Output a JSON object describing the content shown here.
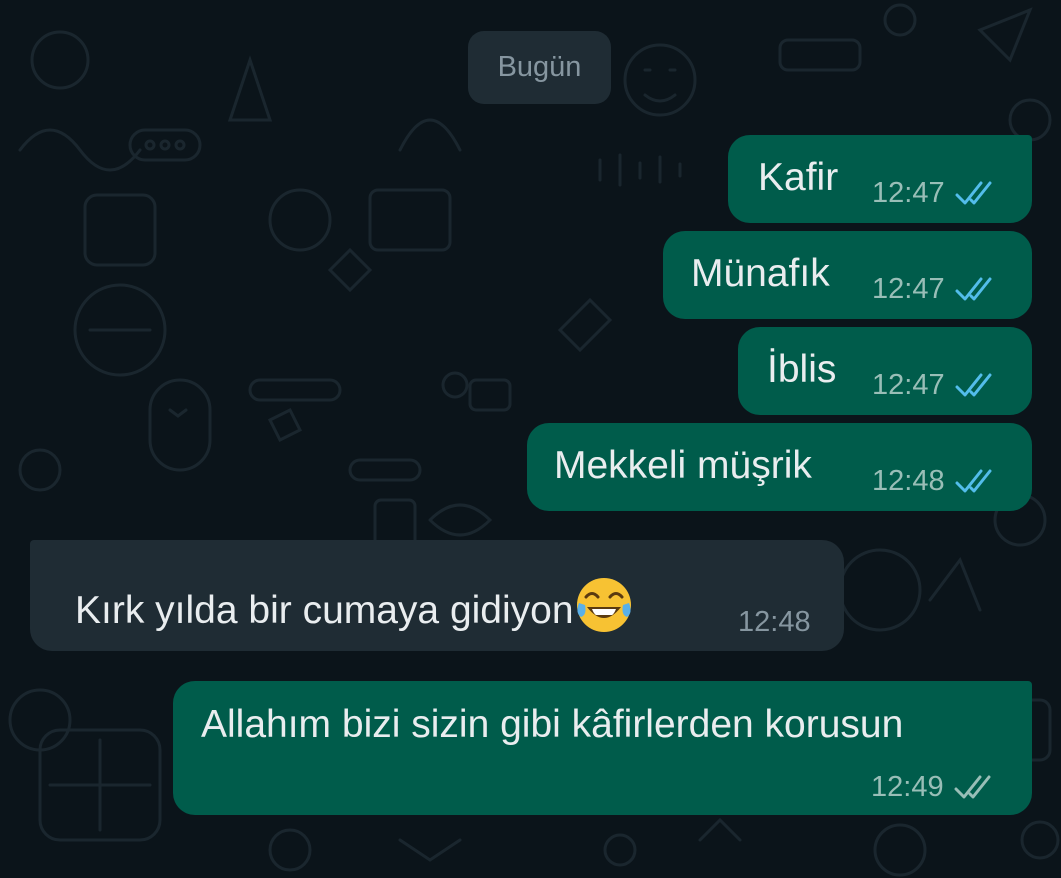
{
  "chat": {
    "date_label": "Bugün",
    "messages": [
      {
        "direction": "out",
        "text": "Kafir",
        "time": "12:47",
        "status": "read"
      },
      {
        "direction": "out",
        "text": "Münafık",
        "time": "12:47",
        "status": "read"
      },
      {
        "direction": "out",
        "text": "İblis",
        "time": "12:47",
        "status": "read"
      },
      {
        "direction": "out",
        "text": "Mekkeli müşrik",
        "time": "12:48",
        "status": "read"
      },
      {
        "direction": "in",
        "text": "Kırk yılda bir cumaya gidiyon",
        "emoji": "face-with-tears-of-joy",
        "time": "12:48"
      },
      {
        "direction": "out",
        "text": "Allahım bizi sizin gibi kâfirlerden korusun",
        "time": "12:49",
        "status": "delivered"
      }
    ]
  },
  "colors": {
    "background": "#0b141a",
    "outgoing_bubble": "#005c4b",
    "incoming_bubble": "#1f2c34",
    "read_tick": "#53bdeb",
    "delivered_tick": "#99beb7"
  },
  "icons": {
    "read": "double-check-blue-icon",
    "delivered": "double-check-gray-icon"
  }
}
